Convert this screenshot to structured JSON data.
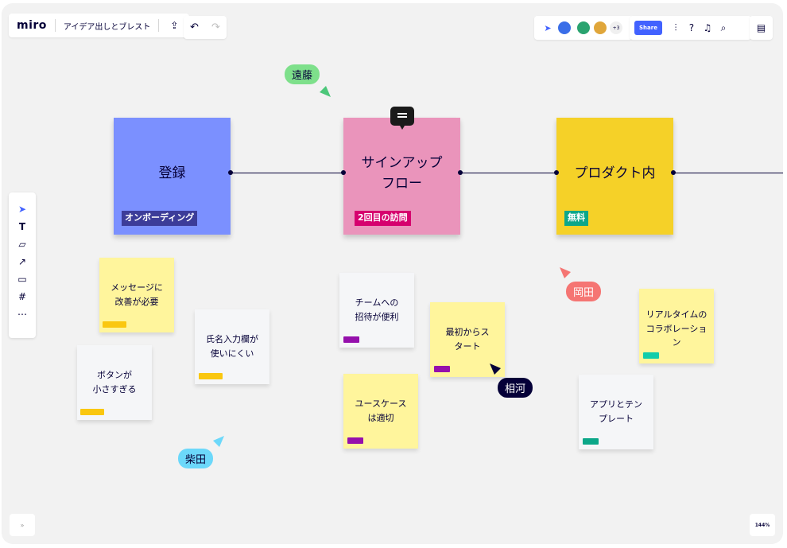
{
  "app": {
    "logo": "miro",
    "board_title": "アイデア出しとブレスト"
  },
  "header": {
    "share_label": "Share",
    "more_count": "+3"
  },
  "colors": {
    "canvas": "#f2f2f2",
    "blue_sticky": "#7b90ff",
    "pink_sticky": "#ea94bb",
    "yellow_big": "#f5d128",
    "yellow_light": "#fff59c",
    "gray_sticky": "#f5f6f8",
    "accent": "#4262ff"
  },
  "big_stickies": [
    {
      "text": "登録",
      "tag": "オンボーディング",
      "tag_color": "#3c3c99"
    },
    {
      "text": "サインアップ\nフロー",
      "tag": "2回目の訪問",
      "tag_color": "#d6006e"
    },
    {
      "text": "プロダクト内",
      "tag": "無料",
      "tag_color": "#0ca789"
    }
  ],
  "stickies": [
    {
      "text": "メッセージに\n改善が必要",
      "bar_color": "#fac710"
    },
    {
      "text": "氏名入力欄が\n使いにくい",
      "bar_color": "#fac710"
    },
    {
      "text": "ボタンが\n小さすぎる",
      "bar_color": "#fac710"
    },
    {
      "text": "チームへの\n招待が便利",
      "bar_color": "#9510ac"
    },
    {
      "text": "最初からス\nタート",
      "bar_color": "#9510ac"
    },
    {
      "text": "ユースケース\nは適切",
      "bar_color": "#9510ac"
    },
    {
      "text": "リアルタイムの\nコラボレーショ\nン",
      "bar_color": "#12cdaa"
    },
    {
      "text": "アプリとテン\nプレート",
      "bar_color": "#0ca789"
    }
  ],
  "cursors": [
    {
      "name": "遠藤",
      "bg": "#7ee08b",
      "fg": "#050038"
    },
    {
      "name": "岡田",
      "bg": "#f57573",
      "fg": "#ffffff"
    },
    {
      "name": "相河",
      "bg": "#050038",
      "fg": "#ffffff"
    },
    {
      "name": "柴田",
      "bg": "#6cd8fa",
      "fg": "#050038"
    }
  ],
  "zoom": "144%",
  "toolbar_icons": [
    "select-icon",
    "text-icon",
    "sticky-note-icon",
    "arrow-icon",
    "comment-icon",
    "frame-icon",
    "more-icon"
  ]
}
